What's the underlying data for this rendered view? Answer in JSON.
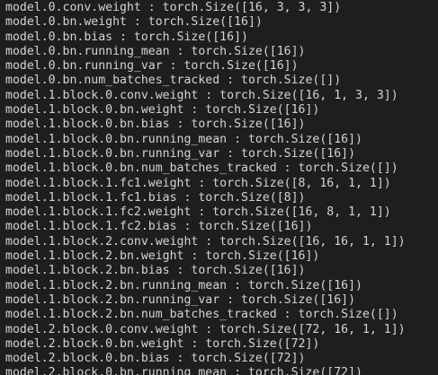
{
  "terminal": {
    "lines": [
      "model.0.conv.weight : torch.Size([16, 3, 3, 3])",
      "model.0.bn.weight : torch.Size([16])",
      "model.0.bn.bias : torch.Size([16])",
      "model.0.bn.running_mean : torch.Size([16])",
      "model.0.bn.running_var : torch.Size([16])",
      "model.0.bn.num_batches_tracked : torch.Size([])",
      "model.1.block.0.conv.weight : torch.Size([16, 1, 3, 3])",
      "model.1.block.0.bn.weight : torch.Size([16])",
      "model.1.block.0.bn.bias : torch.Size([16])",
      "model.1.block.0.bn.running_mean : torch.Size([16])",
      "model.1.block.0.bn.running_var : torch.Size([16])",
      "model.1.block.0.bn.num_batches_tracked : torch.Size([])",
      "model.1.block.1.fc1.weight : torch.Size([8, 16, 1, 1])",
      "model.1.block.1.fc1.bias : torch.Size([8])",
      "model.1.block.1.fc2.weight : torch.Size([16, 8, 1, 1])",
      "model.1.block.1.fc2.bias : torch.Size([16])",
      "model.1.block.2.conv.weight : torch.Size([16, 16, 1, 1])",
      "model.1.block.2.bn.weight : torch.Size([16])",
      "model.1.block.2.bn.bias : torch.Size([16])",
      "model.1.block.2.bn.running_mean : torch.Size([16])",
      "model.1.block.2.bn.running_var : torch.Size([16])",
      "model.1.block.2.bn.num_batches_tracked : torch.Size([])",
      "model.2.block.0.conv.weight : torch.Size([72, 16, 1, 1])",
      "model.2.block.0.bn.weight : torch.Size([72])",
      "model.2.block.0.bn.bias : torch.Size([72])",
      "model.2.block.0.bn.running_mean : torch.Size([72])"
    ]
  }
}
